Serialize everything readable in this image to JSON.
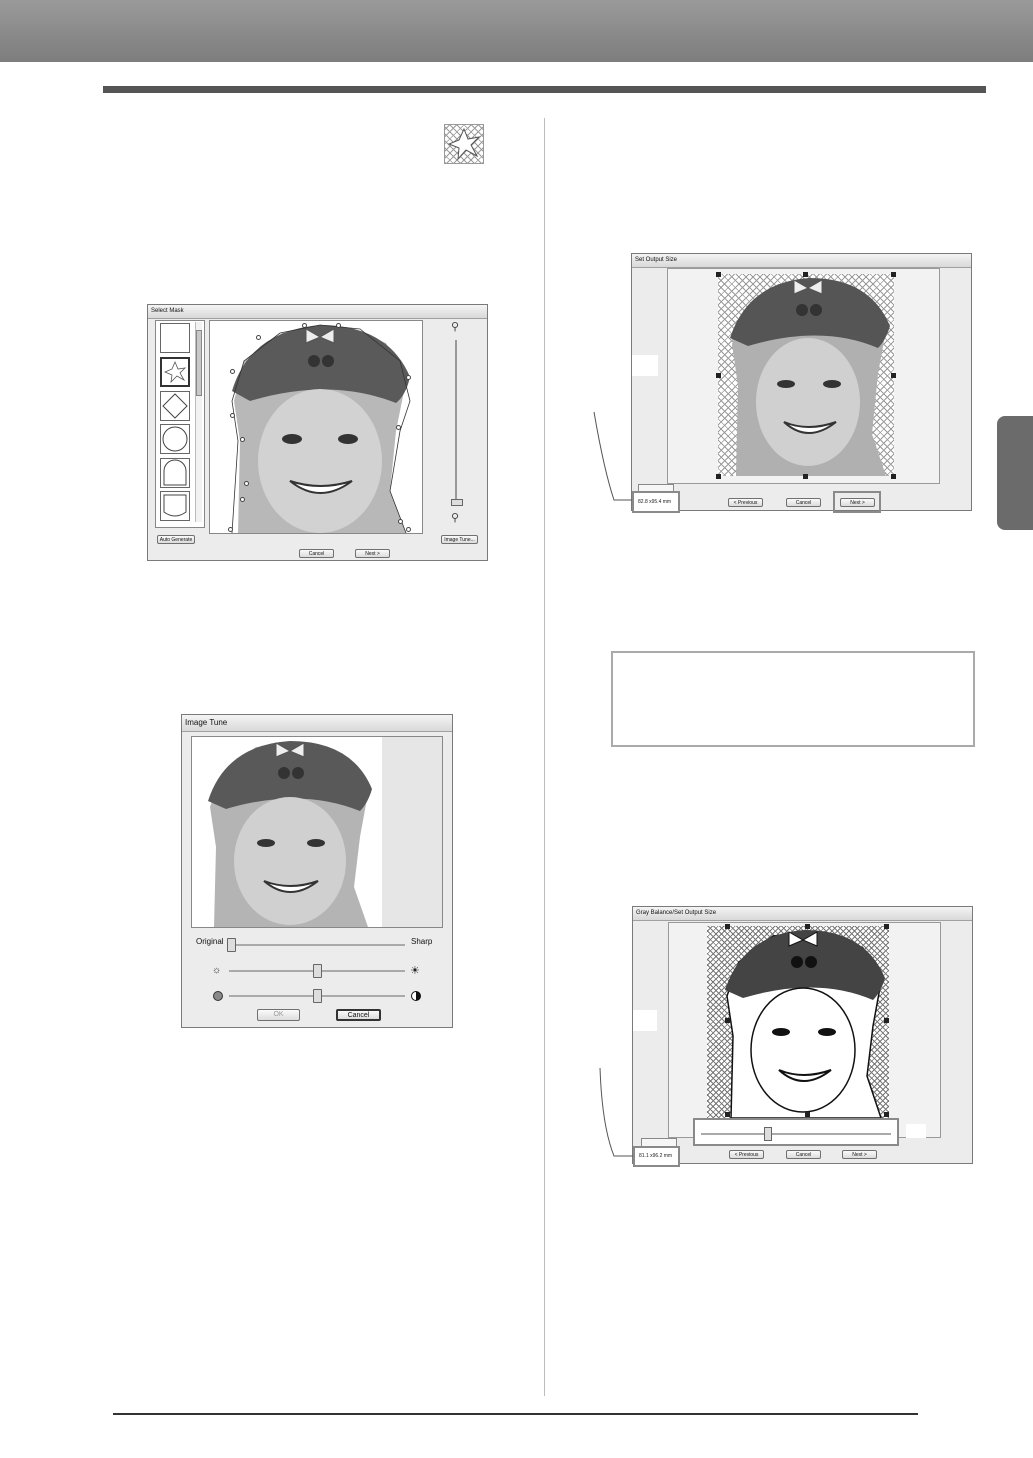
{
  "select_mask": {
    "title": "Select Mask",
    "auto_generate": "Auto Generate",
    "image_tune": "Image Tune...",
    "cancel": "Cancel",
    "next": "Next >"
  },
  "image_tune_dialog": {
    "title": "Image Tune",
    "original_label": "Original",
    "sharp_label": "Sharp",
    "ok": "OK",
    "cancel": "Cancel",
    "sharpness": 0.0,
    "brightness": 0.5,
    "contrast": 0.5
  },
  "set_output_size": {
    "title": "Set Output Size",
    "size_readout": "82.8 x95.4 mm",
    "previous": "< Previous",
    "cancel": "Cancel",
    "next": "Next >"
  },
  "gray_balance": {
    "title": "Gray Balance/Set Output Size",
    "size_readout": "81.1 x96.2 mm",
    "previous": "< Previous",
    "cancel": "Cancel",
    "next": "Next >",
    "gray_level": 0.35
  }
}
